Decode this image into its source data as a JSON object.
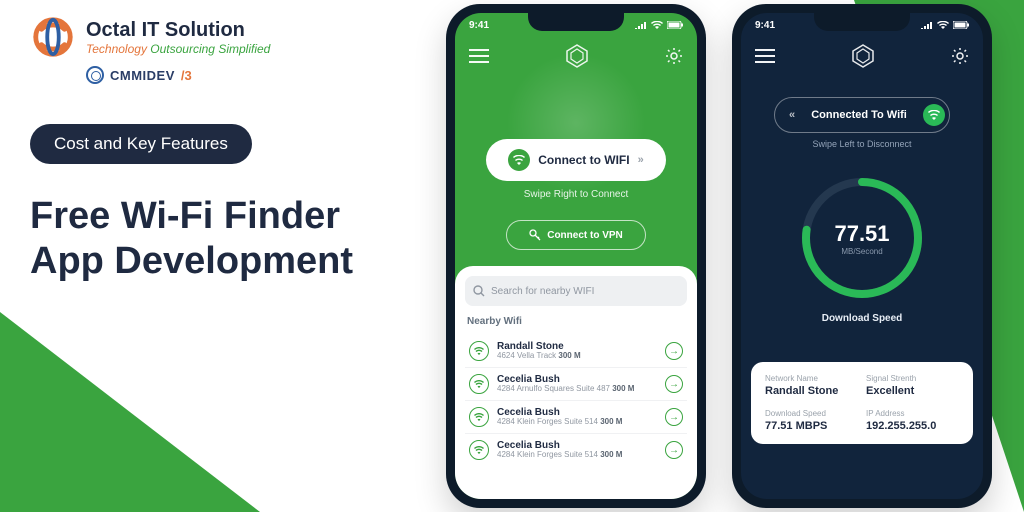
{
  "brand": {
    "name": "Octal IT Solution",
    "tagline_prefix": "Technology ",
    "tagline_em": "Outsourcing Simplified",
    "cmmi_label": "CMMIDEV",
    "cmmi_level": "/3"
  },
  "chip_label": "Cost and Key Features",
  "headline_line1": "Free Wi-Fi Finder",
  "headline_line2": "App Development",
  "statusbar": {
    "time": "9:41"
  },
  "phone1": {
    "connect_label": "Connect to WIFI",
    "swipe_hint": "Swipe Right to Connect",
    "vpn_label": "Connect to VPN",
    "search_placeholder": "Search for nearby WIFI",
    "section_label": "Nearby Wifi",
    "wifi_list": [
      {
        "name": "Randall Stone",
        "address": "4624 Vella Track",
        "distance": "300 M"
      },
      {
        "name": "Cecelia Bush",
        "address": "4284 Arnulfo Squares Suite 487",
        "distance": "300 M"
      },
      {
        "name": "Cecelia Bush",
        "address": "4284 Klein Forges Suite 514",
        "distance": "300 M"
      },
      {
        "name": "Cecelia Bush",
        "address": "4284 Klein Forges Suite 514",
        "distance": "300 M"
      }
    ]
  },
  "phone2": {
    "connected_label": "Connected To Wifi",
    "swipe_hint": "Swipe Left to Disconnect",
    "gauge_value": "77.51",
    "gauge_unit": "MB/Second",
    "speed_label": "Download Speed",
    "info": {
      "network_name_k": "Network Name",
      "network_name_v": "Randall Stone",
      "signal_k": "Signal Strenth",
      "signal_v": "Excellent",
      "dl_k": "Download Speed",
      "dl_v": "77.51 MBPS",
      "ip_k": "IP Address",
      "ip_v": "192.255.255.0"
    }
  },
  "colors": {
    "green": "#3aa43f",
    "dark": "#11243c",
    "navy": "#1f2a41",
    "orange": "#e4753b"
  }
}
